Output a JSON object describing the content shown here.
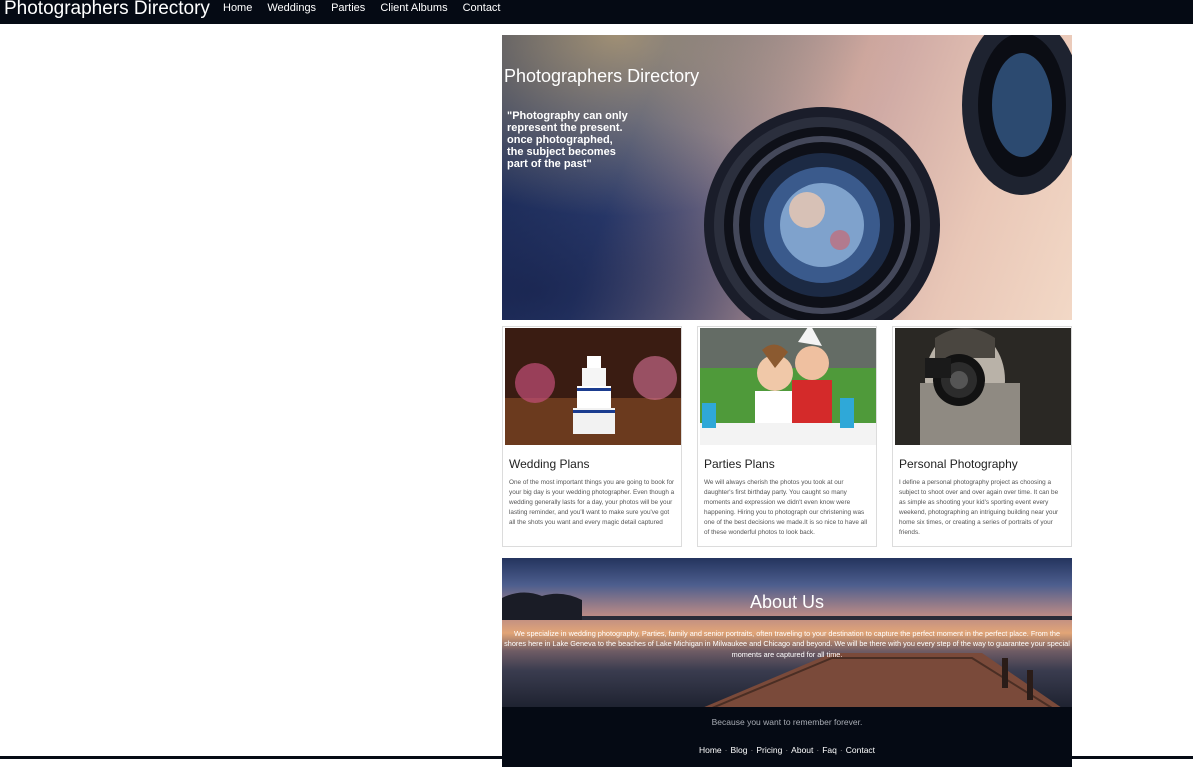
{
  "header": {
    "brand": "Photographers Directory",
    "nav": [
      "Home",
      "Weddings",
      "Parties",
      "Client Albums",
      "Contact"
    ]
  },
  "hero": {
    "title": "Photographers Directory",
    "quote": "\"Photography can only represent the present. once photographed, the subject becomes part of the past\""
  },
  "cards": [
    {
      "title": "Wedding Plans",
      "desc": "One of the most important things you are going to book for your big day is your wedding photographer. Even though a wedding generally lasts for a day, your photos will be your lasting reminder, and you'll want to make sure you've got all the shots you want and every magic detail captured"
    },
    {
      "title": "Parties Plans",
      "desc": "We will always cherish the photos you took at our daughter's first birthday party. You caught so many moments and expression we didn't even know were happening. Hiring you to photograph our christening was one of the best decisions we made.It is so nice to have all of these wonderful photos to look back."
    },
    {
      "title": "Personal Photography",
      "desc": "I define a personal photography project as choosing a subject to shoot over and over again over time. It can be as simple as shooting your kid's sporting event every weekend, photographing an intriguing building near your home six times, or creating a series of portraits of your friends."
    }
  ],
  "about": {
    "title": "About Us",
    "text": "We specialize in wedding photography, Parties, family and senior portraits, often traveling to your destination to capture the perfect moment in the perfect place. From the shores here in Lake Geneva to the beaches of Lake Michigan in Milwaukee and Chicago and beyond. We will be there with you every step of the way to guarantee your special moments are captured for all time."
  },
  "footer": {
    "tagline": "Because you want to remember forever.",
    "links": [
      "Home",
      "Blog",
      "Pricing",
      "About",
      "Faq",
      "Contact"
    ]
  }
}
